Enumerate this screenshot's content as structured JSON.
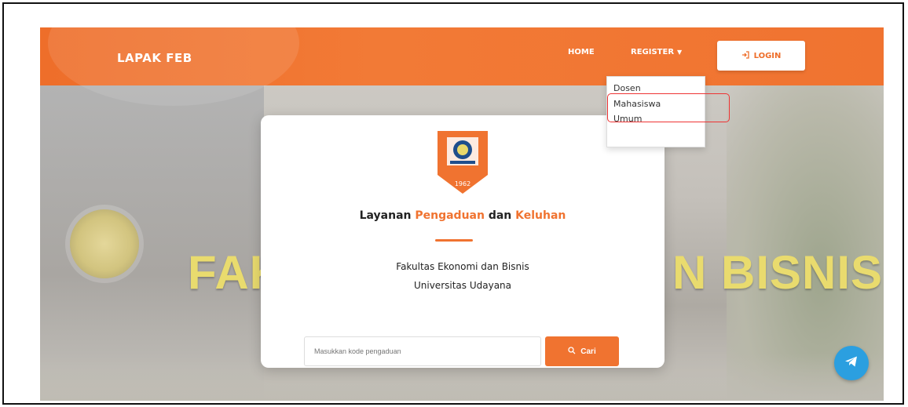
{
  "header": {
    "brand": "LAPAK FEB",
    "nav_home": "HOME",
    "nav_register": "REGISTER",
    "login_label": "LOGIN"
  },
  "dropdown": {
    "items": [
      "Dosen",
      "Mahasiswa",
      "Umum"
    ]
  },
  "background": {
    "sign_left": "FAK",
    "sign_right": "N BISNIS"
  },
  "card": {
    "title_part1": "Layanan ",
    "title_part2": "Pengaduan",
    "title_part3": " dan ",
    "title_part4": "Keluhan",
    "subtitle_line1": "Fakultas Ekonomi dan Bisnis",
    "subtitle_line2": "Universitas Udayana",
    "search": {
      "placeholder": "Masukkan kode pengaduan",
      "button_label": "Cari"
    },
    "logo_text": "1962"
  },
  "colors": {
    "accent": "#f07330",
    "highlight": "#e33333",
    "telegram": "#2b9fe0"
  },
  "icons": {
    "login": "sign-in-icon",
    "search": "search-icon",
    "telegram": "telegram-icon",
    "register_caret": "caret-down-icon"
  }
}
